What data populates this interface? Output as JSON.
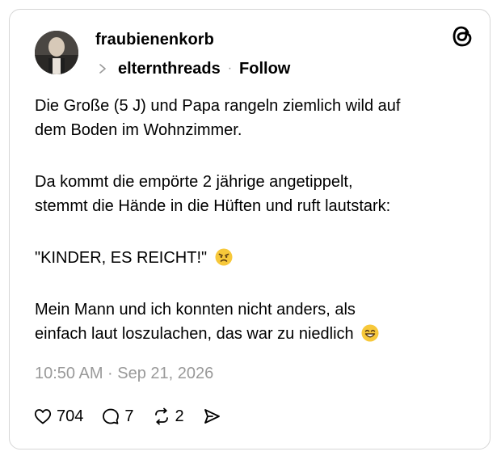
{
  "post": {
    "username": "fraubienenkorb",
    "channel": "elternthreads",
    "separator": "·",
    "follow_label": "Follow",
    "paragraphs": [
      [
        "Die Große (5 J) und Papa rangeln ziemlich wild auf",
        "dem Boden im Wohnzimmer."
      ],
      [
        "Da kommt die empörte 2 jährige angetippelt,",
        "stemmt die Hände in die Hüften und ruft lautstark:"
      ],
      [
        "\"KINDER, ES REICHT!\""
      ],
      [
        "Mein Mann und ich konnten nicht anders, als",
        "einfach laut loszulachen, das war zu niedlich"
      ]
    ],
    "timestamp": "10:50 AM · Sep 21, 2026",
    "emojis": {
      "angry": "angry-face-emoji",
      "grin": "grinning-face-emoji"
    }
  },
  "actions": {
    "likes": "704",
    "replies": "7",
    "reposts": "2"
  },
  "colors": {
    "text": "#000000",
    "muted": "#999999",
    "border": "#d6d6d6",
    "emoji": "#f7c83a"
  }
}
